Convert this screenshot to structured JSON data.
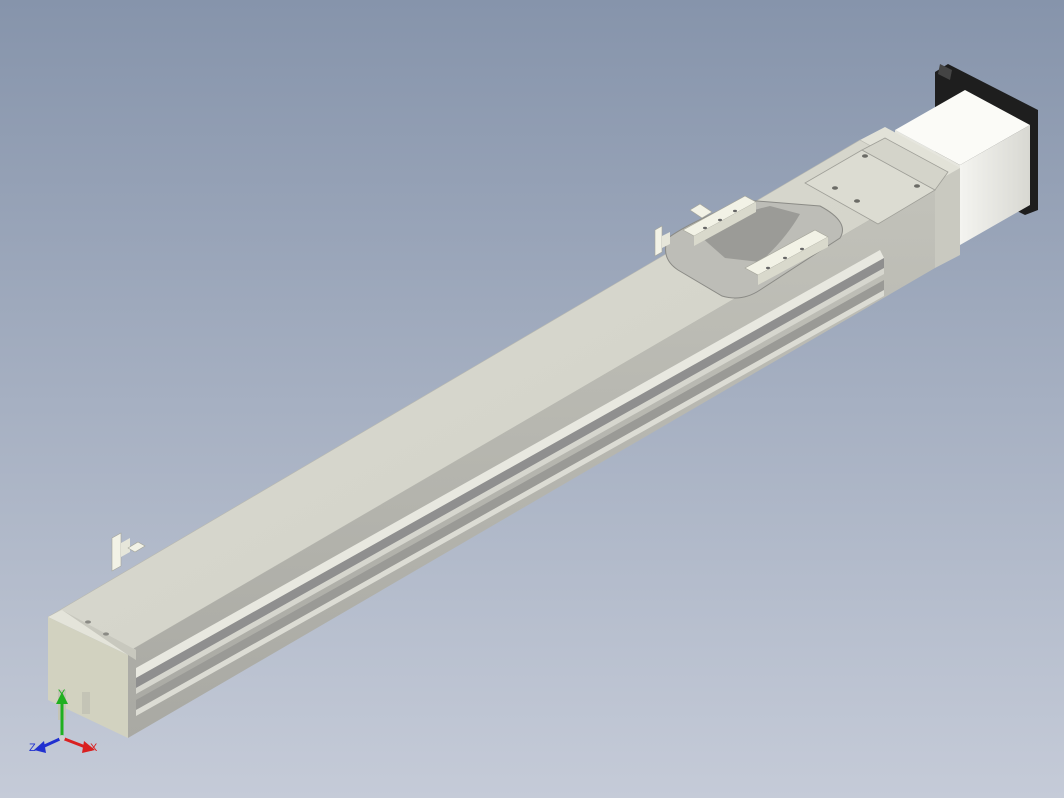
{
  "viewport": {
    "background_top": "#8694ab",
    "background_bottom": "#c5cbd8",
    "part_color": "#d9d9cf",
    "slot_color": "#8f8f8f",
    "clip_color": "#f2f2e6",
    "motor_flange_color": "#1e1e1e"
  },
  "triad": {
    "x_label": "X",
    "y_label": "Y",
    "z_label": "Z",
    "x_color": "#d92020",
    "y_color": "#20b020",
    "z_color": "#2030d0"
  }
}
